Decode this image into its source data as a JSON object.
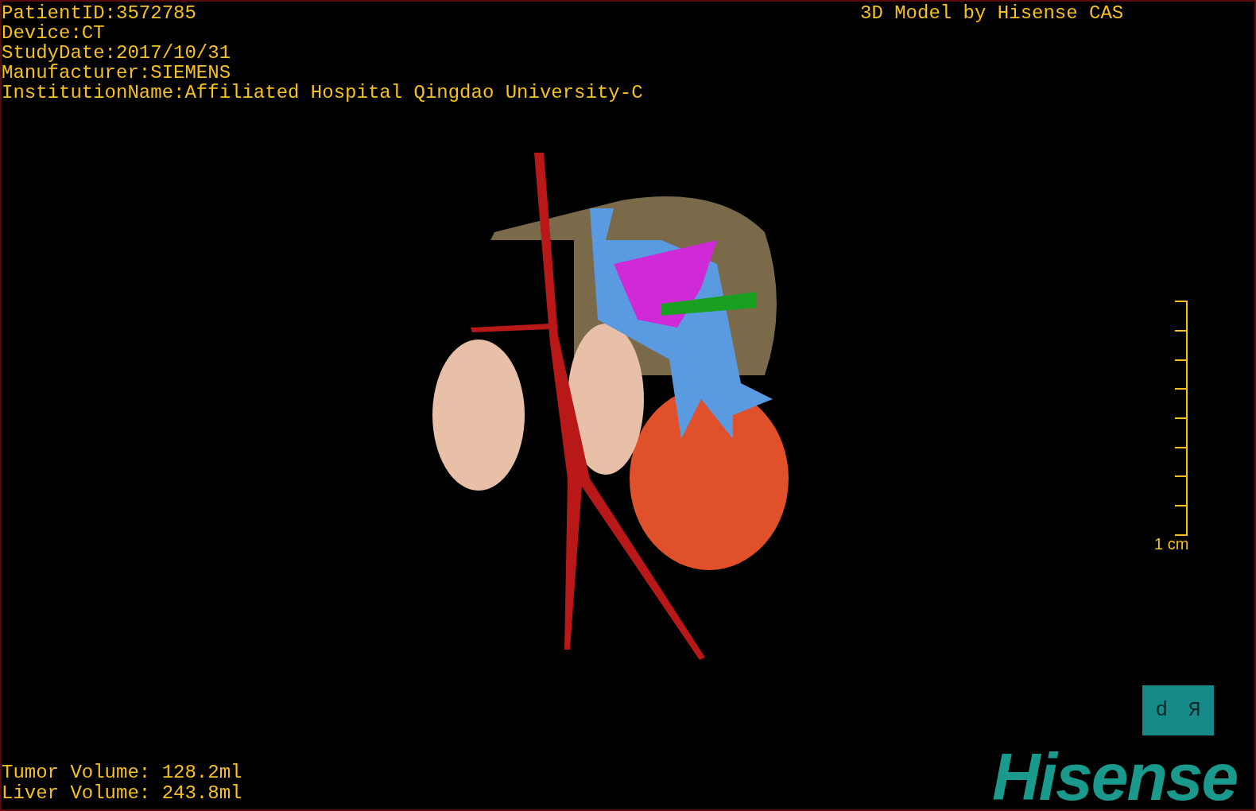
{
  "patient_info": [
    "PatientID:3572785",
    "Device:CT",
    "StudyDate:2017/10/31",
    "Manufacturer:SIEMENS",
    "InstitutionName:Affiliated Hospital Qingdao University-C"
  ],
  "title": "3D Model by Hisense CAS",
  "scale_bar": {
    "label": "1 cm"
  },
  "orientation_marker": {
    "left": "d",
    "right": "R"
  },
  "volumes": [
    "Tumor Volume: 128.2ml",
    "Liver Volume: 243.8ml"
  ],
  "logo": "Hisense"
}
